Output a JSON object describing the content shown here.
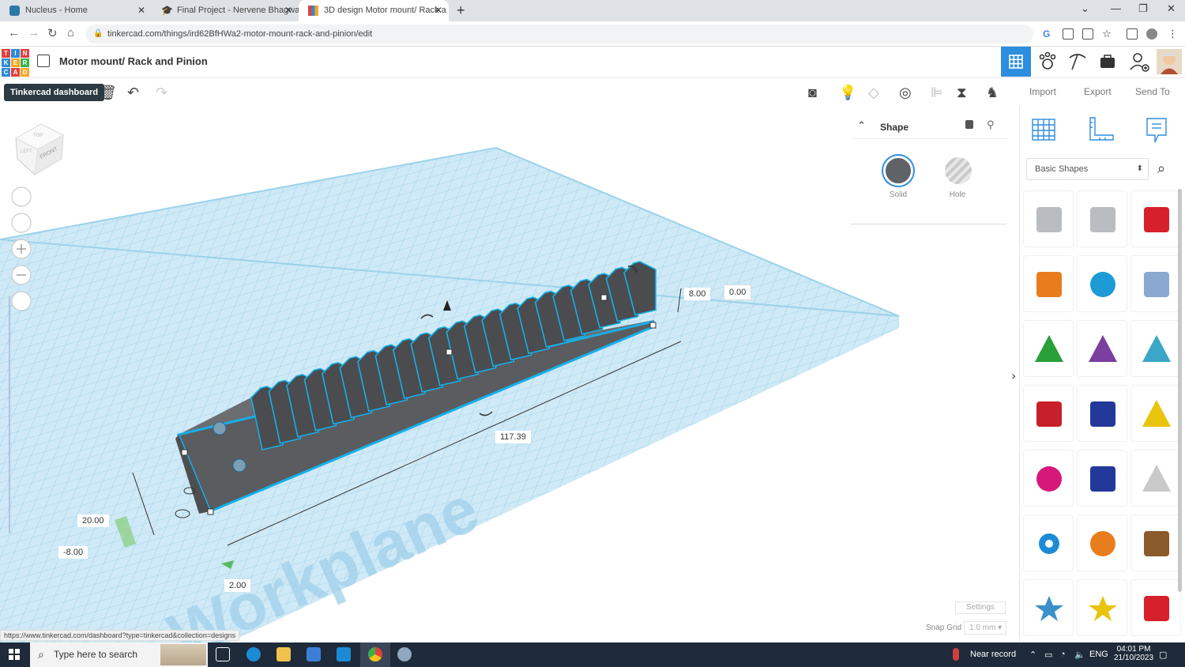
{
  "browser": {
    "tabs": [
      {
        "title": "Nucleus - Home",
        "active": false
      },
      {
        "title": "Final Project - Nervene Bhagwa",
        "active": false
      },
      {
        "title": "3D design Motor mount/ Rack a",
        "active": true
      }
    ],
    "url": "tinkercad.com/things/ird62BfHWa2-motor-mount-rack-and-pinion/edit",
    "status_url": "https://www.tinkercad.com/dashboard?type=tinkercad&collection=designs"
  },
  "app": {
    "logo_letters": [
      "T",
      "I",
      "N",
      "K",
      "E",
      "R",
      "C",
      "A",
      "D"
    ],
    "logo_colors": [
      "#e2413c",
      "#2c8bd7",
      "#e2413c",
      "#2c8bd7",
      "#f5a623",
      "#3bb04a",
      "#2c8bd7",
      "#e2413c",
      "#f5a623"
    ],
    "design_title": "Motor mount/ Rack and Pinion",
    "tooltip": "Tinkercad dashboard",
    "accent": "#2d8ddf"
  },
  "toolbar": {
    "import_label": "Import",
    "export_label": "Export",
    "send_to_label": "Send To"
  },
  "viewcube": {
    "face_label": "FRONT",
    "top_label": "TOP",
    "side_label": "LEFT"
  },
  "workplane_label": "Workplane",
  "dimensions": {
    "height": "8.00",
    "elevation": "0.00",
    "length": "117.39",
    "width": "20.00",
    "offset_y": "-8.00",
    "offset_x": "2.00"
  },
  "inspector": {
    "title": "Shape",
    "solid_label": "Solid",
    "hole_label": "Hole",
    "solid_color": "#5f6368"
  },
  "shapes_panel": {
    "category": "Basic Shapes",
    "shapes": [
      {
        "name": "box-hole",
        "color": "#b9bcc0"
      },
      {
        "name": "cylinder-hole",
        "color": "#b9bcc0"
      },
      {
        "name": "box",
        "color": "#d6202a"
      },
      {
        "name": "cylinder",
        "color": "#e87d1e"
      },
      {
        "name": "sphere",
        "color": "#1c9bd6"
      },
      {
        "name": "scribble",
        "color": "#8aa8d0"
      },
      {
        "name": "roof",
        "color": "#2aa03a"
      },
      {
        "name": "cone",
        "color": "#7b3fa0"
      },
      {
        "name": "round-roof",
        "color": "#3aa6c8"
      },
      {
        "name": "text",
        "color": "#c8202a"
      },
      {
        "name": "wedge",
        "color": "#22399a"
      },
      {
        "name": "pyramid",
        "color": "#e8c40c"
      },
      {
        "name": "half-sphere",
        "color": "#d6187a"
      },
      {
        "name": "polygon",
        "color": "#22399a"
      },
      {
        "name": "paraboloid",
        "color": "#c9c9c9"
      },
      {
        "name": "torus",
        "color": "#1c8bd6"
      },
      {
        "name": "tube",
        "color": "#e87d1e"
      },
      {
        "name": "heart",
        "color": "#8a5a2a"
      },
      {
        "name": "star",
        "color": "#3a90c8"
      },
      {
        "name": "star-yellow",
        "color": "#e8c40c"
      },
      {
        "name": "icosahedron",
        "color": "#d6202a"
      }
    ]
  },
  "footer": {
    "settings_label": "Settings",
    "snap_label": "Snap Grid",
    "snap_value": "1.0 mm"
  },
  "taskbar": {
    "search_placeholder": "Type here to search",
    "weather": "Near record",
    "language": "ENG",
    "time": "04:01 PM",
    "date": "21/10/2023"
  }
}
